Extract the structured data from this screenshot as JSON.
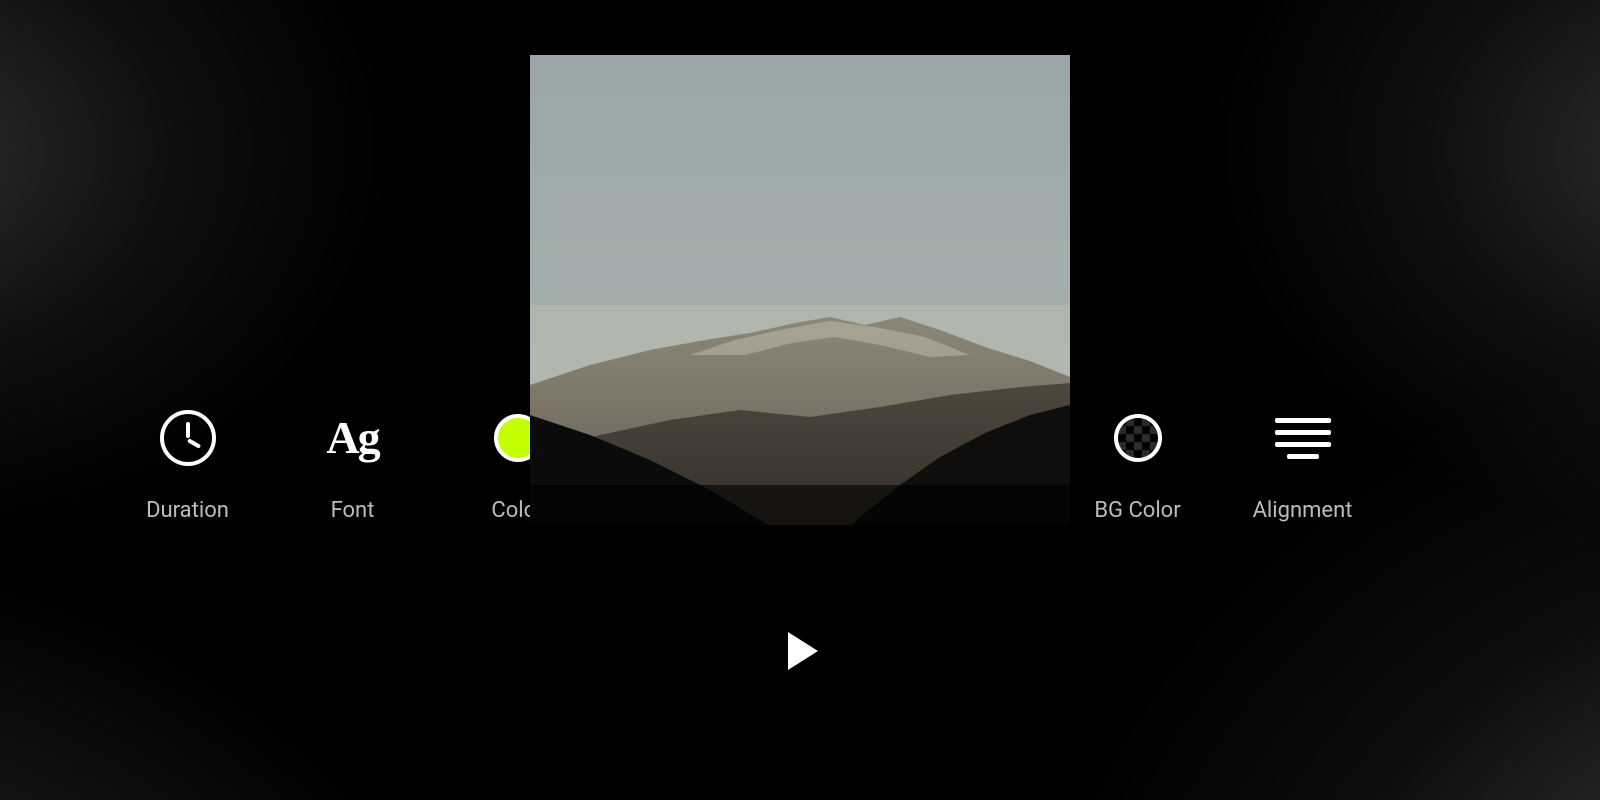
{
  "toolbar_left": {
    "duration": {
      "label": "Duration"
    },
    "font": {
      "label": "Font",
      "glyph": "Ag"
    },
    "color": {
      "label": "Color",
      "swatch_hex": "#c4ff00"
    }
  },
  "toolbar_right": {
    "bg_color": {
      "label": "BG Color"
    },
    "alignment": {
      "label": "Alignment"
    }
  },
  "preview": {
    "play_visible": true
  },
  "colors": {
    "accent": "#c4ff00",
    "label": "#b9bcc0"
  }
}
